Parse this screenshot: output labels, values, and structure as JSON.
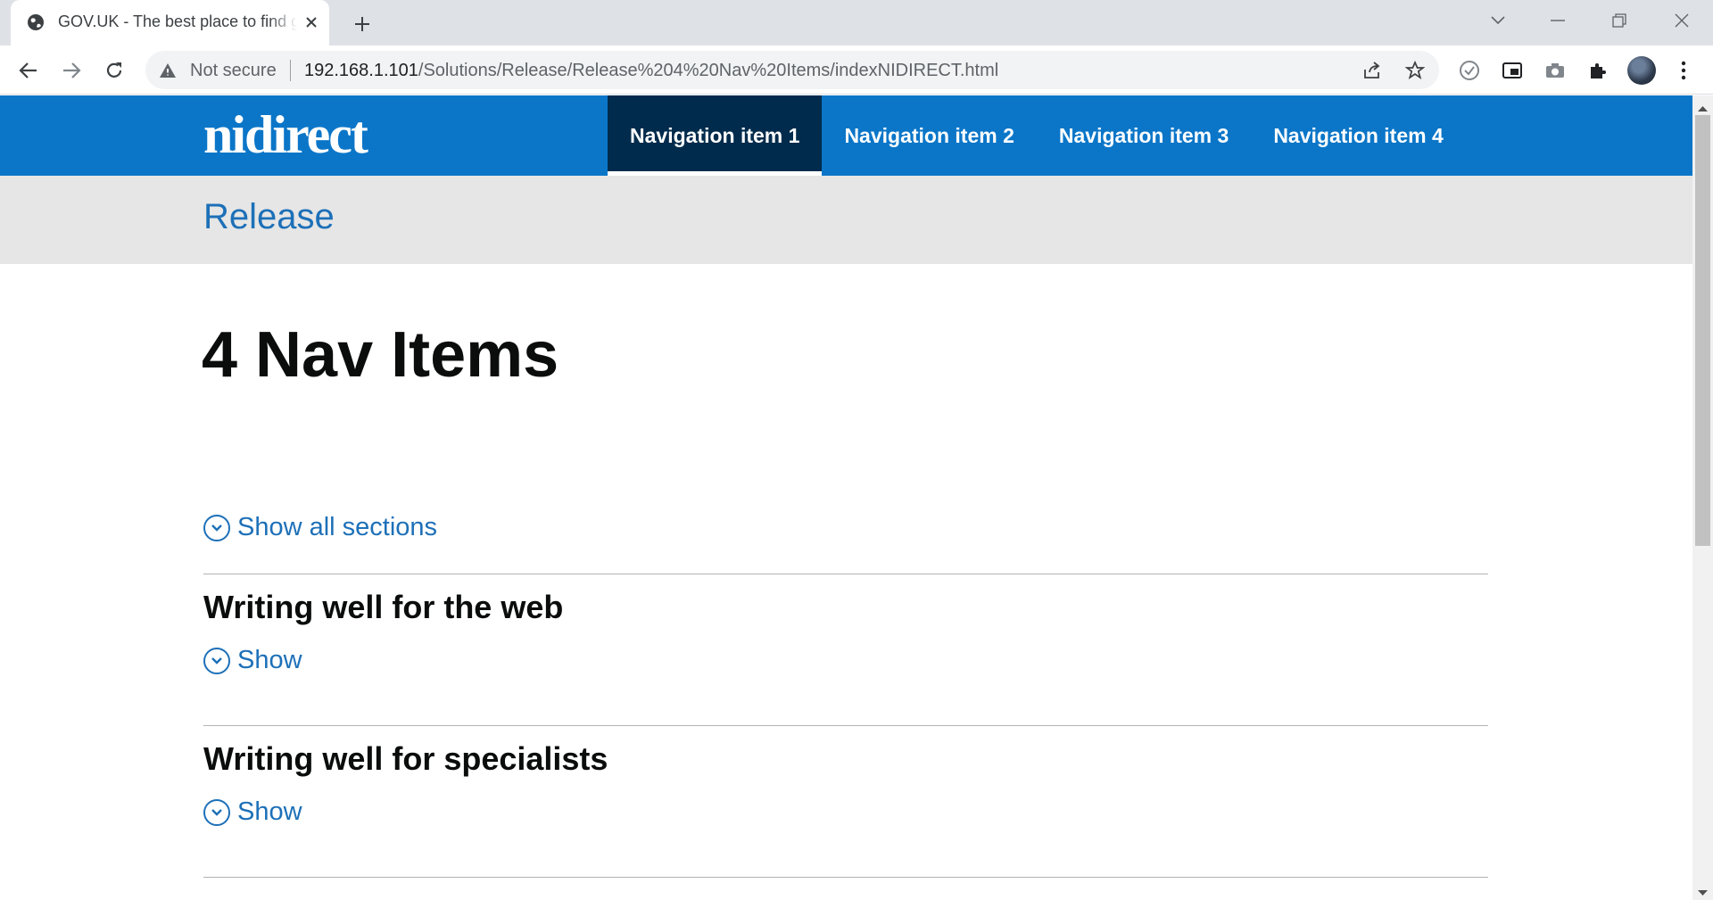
{
  "browser": {
    "tab_title": "GOV.UK - The best place to find government services and information",
    "security_label": "Not secure",
    "url_host": "192.168.1.101",
    "url_path": "/Solutions/Release/Release%204%20Nav%20Items/indexNIDIRECT.html"
  },
  "site": {
    "logo_text": "nidirect",
    "nav_items": [
      "Navigation item 1",
      "Navigation item 2",
      "Navigation item 3",
      "Navigation item 4"
    ],
    "active_nav_index": 0,
    "release_label": "Release",
    "page_title": "4 Nav Items",
    "show_all_label": "Show all sections",
    "sections": [
      {
        "title": "Writing well for the web",
        "toggle_label": "Show"
      },
      {
        "title": "Writing well for specialists",
        "toggle_label": "Show"
      }
    ]
  },
  "colors": {
    "header_blue": "#0b76c8",
    "active_nav": "#002b4c",
    "link_blue": "#1d70b8",
    "release_bar": "#e6e6e6"
  }
}
